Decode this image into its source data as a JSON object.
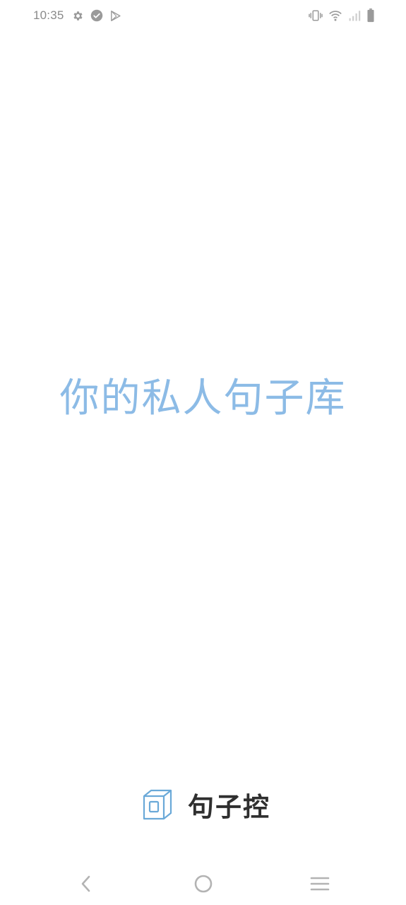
{
  "status_bar": {
    "time": "10:35",
    "left_icons": [
      "settings-gear-icon",
      "check-circle-icon",
      "play-store-icon"
    ],
    "right_icons": [
      "vibrate-icon",
      "wifi-icon",
      "cell-signal-icon",
      "battery-icon"
    ]
  },
  "main": {
    "slogan": "你的私人句子库"
  },
  "brand": {
    "logo_icon": "cube-logo-icon",
    "name": "句子控"
  },
  "nav_bar": {
    "back": "back-chevron-icon",
    "home": "home-circle-icon",
    "menu": "menu-lines-icon"
  },
  "colors": {
    "slogan": "#8cbbe6",
    "brand_text": "#2f2f2f",
    "logo": "#6aa9d8",
    "system_icons": "#9a9a9a"
  }
}
